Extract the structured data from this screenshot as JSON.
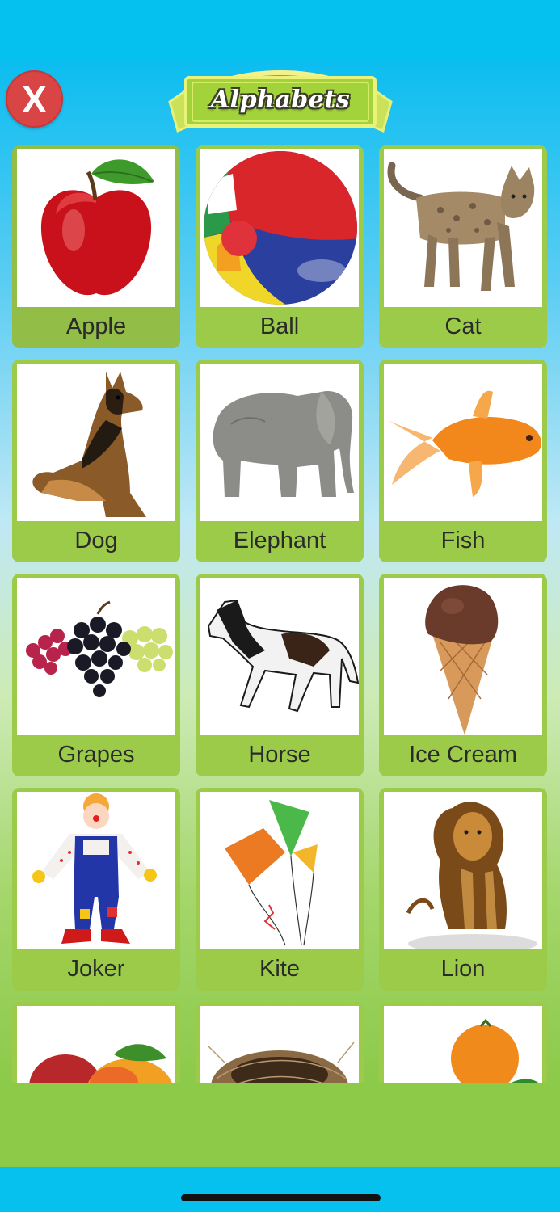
{
  "header": {
    "title": "Alphabets",
    "close_label": "X"
  },
  "colors": {
    "sky": "#05c1f0",
    "card_green": "#9ccb4a",
    "close_red": "#d94545",
    "banner_green": "#a9d944"
  },
  "items": [
    {
      "label": "Apple",
      "icon": "apple-icon"
    },
    {
      "label": "Ball",
      "icon": "ball-icon"
    },
    {
      "label": "Cat",
      "icon": "cat-icon"
    },
    {
      "label": "Dog",
      "icon": "dog-icon"
    },
    {
      "label": "Elephant",
      "icon": "elephant-icon"
    },
    {
      "label": "Fish",
      "icon": "fish-icon"
    },
    {
      "label": "Grapes",
      "icon": "grapes-icon"
    },
    {
      "label": "Horse",
      "icon": "horse-icon"
    },
    {
      "label": "Ice Cream",
      "icon": "ice-cream-icon"
    },
    {
      "label": "Joker",
      "icon": "joker-icon"
    },
    {
      "label": "Kite",
      "icon": "kite-icon"
    },
    {
      "label": "Lion",
      "icon": "lion-icon"
    },
    {
      "label": "",
      "icon": "mango-icon"
    },
    {
      "label": "",
      "icon": "nest-icon"
    },
    {
      "label": "",
      "icon": "orange-icon"
    }
  ]
}
